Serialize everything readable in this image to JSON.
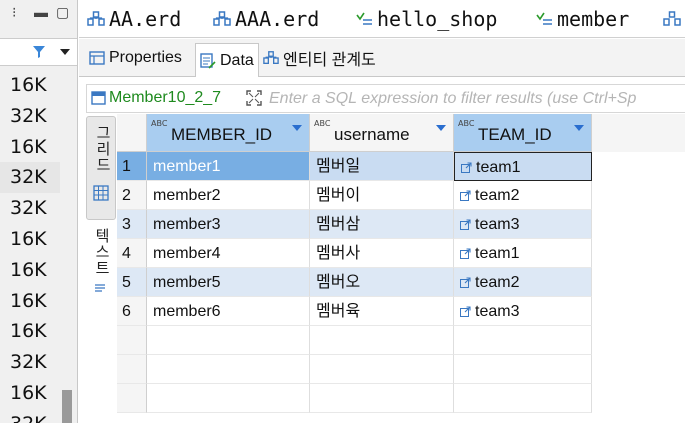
{
  "left_panel": {
    "sizes": [
      "16K",
      "32K",
      "16K",
      "32K",
      "32K",
      "16K",
      "16K",
      "16K",
      "16K",
      "32K",
      "16K",
      "32K"
    ],
    "selected_index": 3
  },
  "editor_tabs": [
    "AA.erd",
    "AAA.erd",
    "hello_shop",
    "member"
  ],
  "sub_tabs": [
    {
      "label": "Properties",
      "icon": "properties-icon"
    },
    {
      "label": "Data",
      "icon": "data-icon"
    },
    {
      "label": "엔티티 관계도",
      "icon": "erd-icon"
    }
  ],
  "active_sub_tab": 1,
  "filter": {
    "entity": "Member10_2_7",
    "placeholder": "Enter a SQL expression to filter results (use Ctrl+Sp"
  },
  "side_tabs": {
    "grid": "그리드",
    "text": "텍스트"
  },
  "grid": {
    "columns": [
      {
        "label": "MEMBER_ID",
        "type_badge": "ABC"
      },
      {
        "label": "username",
        "type_badge": "ABC"
      },
      {
        "label": "TEAM_ID",
        "type_badge": "ABC"
      }
    ],
    "rows": [
      {
        "n": "1",
        "member_id": "member1",
        "username": "멤버일",
        "team_id": "team1"
      },
      {
        "n": "2",
        "member_id": "member2",
        "username": "멤버이",
        "team_id": "team2"
      },
      {
        "n": "3",
        "member_id": "member3",
        "username": "멤버삼",
        "team_id": "team3"
      },
      {
        "n": "4",
        "member_id": "member4",
        "username": "멤버사",
        "team_id": "team1"
      },
      {
        "n": "5",
        "member_id": "member5",
        "username": "멤버오",
        "team_id": "team2"
      },
      {
        "n": "6",
        "member_id": "member6",
        "username": "멤버육",
        "team_id": "team3"
      }
    ]
  },
  "colors": {
    "accent": "#2a6ecf",
    "selected_row": "#78aee3",
    "alt_row": "#dde8f5",
    "entity_green": "#1e8a1e"
  }
}
